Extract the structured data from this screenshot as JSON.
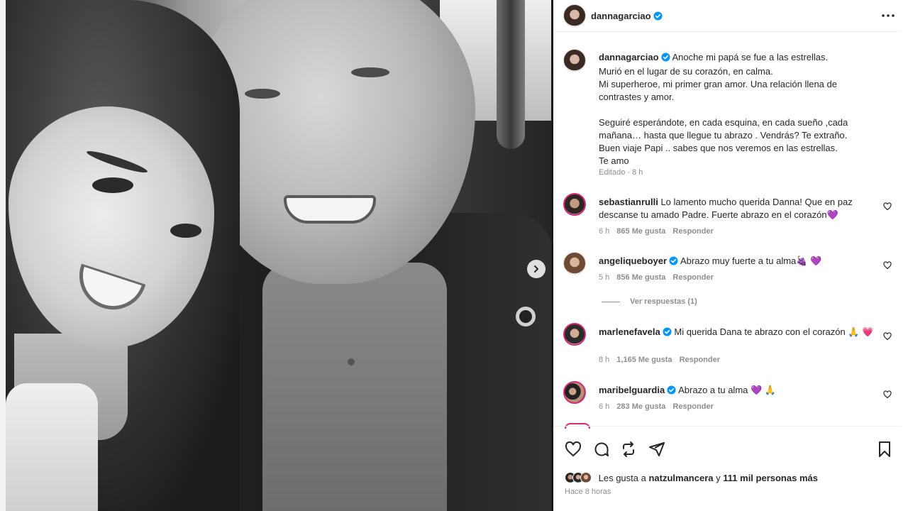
{
  "post": {
    "author": "dannagarciao",
    "caption": "Anoche mi papá se fue a las estrellas.\nMurió en el lugar de su corazón, en calma.\nMi superheroe, mi primer gran amor. Una relación llena de contrastes y amor.\n\nSeguiré esperándote, en cada esquina, en cada sueño ,cada mañana… hasta que llegue tu abrazo . Vendrás? Te extraño.\nBuen viaje Papi .. sabes que nos veremos en las estrellas.\nTe amo",
    "edited_label": "Editado",
    "edited_time": "8 h"
  },
  "comments": [
    {
      "user": "sebastianrulli",
      "verified": false,
      "text": "Lo lamento mucho querida Danna! Que en paz descanse tu amado Padre. Fuerte abrazo en el corazón💜",
      "time": "6 h",
      "likes": "865 Me gusta",
      "reply": "Responder"
    },
    {
      "user": "angeliqueboyer",
      "verified": true,
      "text": "Abrazo muy fuerte a tu alma🍇 💜",
      "time": "5 h",
      "likes": "856 Me gusta",
      "reply": "Responder"
    },
    {
      "user": "marlenefavela",
      "verified": true,
      "text": "Mi querida Dana te abrazo con el corazón 🙏 💗",
      "time": "8 h",
      "likes": "1,165 Me gusta",
      "reply": "Responder"
    },
    {
      "user": "maribelguardia",
      "verified": true,
      "text": "Abrazo a tu alma 💜 🙏",
      "time": "6 h",
      "likes": "283 Me gusta",
      "reply": "Responder"
    }
  ],
  "view_replies": "Ver respuestas (1)",
  "likes": {
    "prefix": "Les gusta a",
    "user": "natzulmancera",
    "mid": "y",
    "count": "111 mil personas más"
  },
  "post_time": "Hace 8 horas",
  "icons": {
    "more": "more-horizontal-icon",
    "heart": "heart-icon",
    "comment": "comment-icon",
    "repost": "repost-icon",
    "share": "share-icon",
    "save": "bookmark-icon",
    "next": "chevron-right-icon",
    "verified": "verified-badge-icon"
  },
  "colors": {
    "verified": "#0095f6",
    "text": "#262626",
    "secondary": "#8e8e8e",
    "story_ring": "#d62976"
  }
}
